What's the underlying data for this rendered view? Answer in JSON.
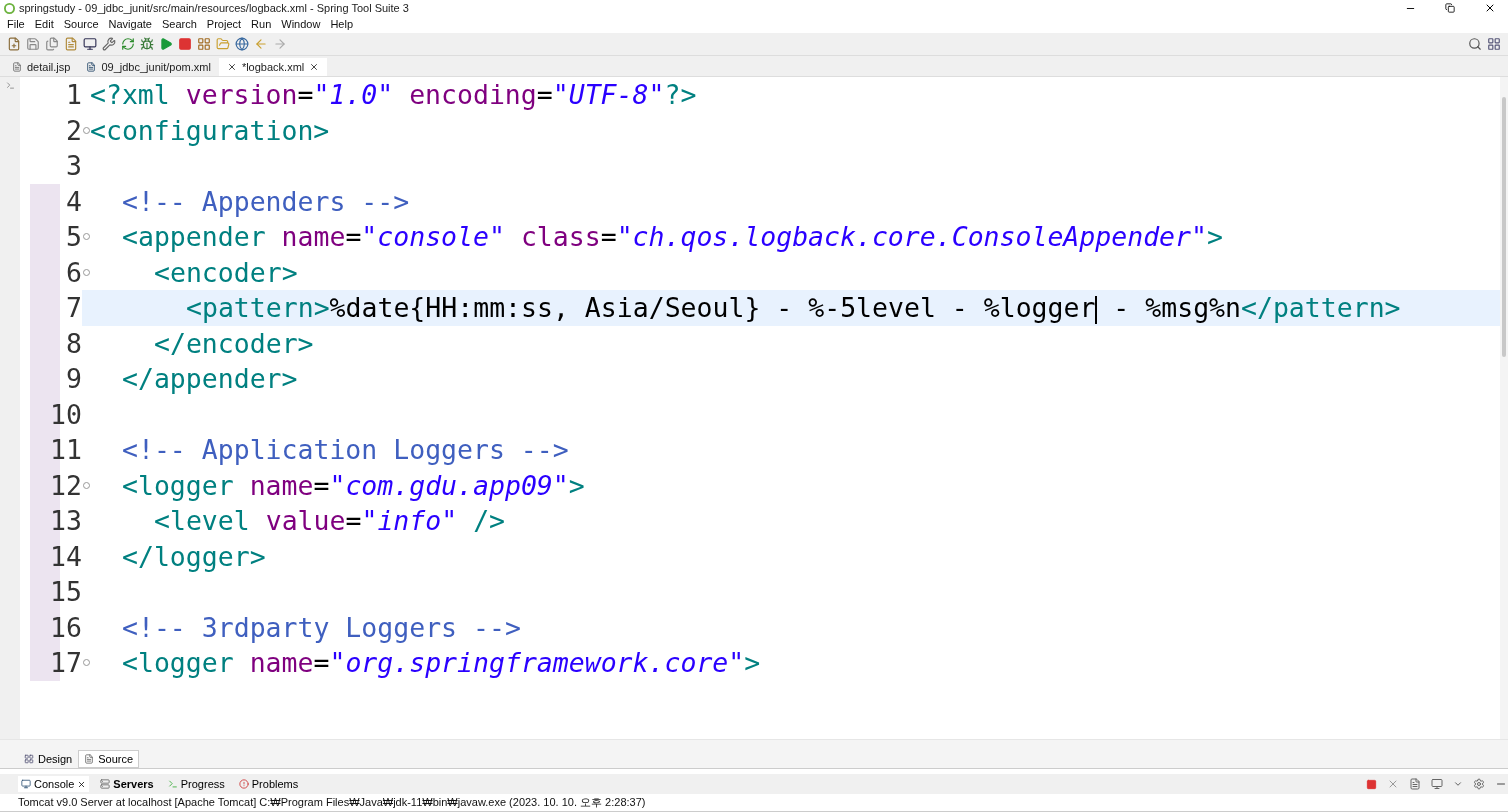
{
  "window": {
    "title": "springstudy - 09_jdbc_junit/src/main/resources/logback.xml - Spring Tool Suite 3"
  },
  "menu": [
    "File",
    "Edit",
    "Source",
    "Navigate",
    "Search",
    "Project",
    "Run",
    "Window",
    "Help"
  ],
  "editor_tabs": [
    {
      "label": "detail.jsp",
      "selected": false,
      "kind": "jsp"
    },
    {
      "label": "09_jdbc_junit/pom.xml",
      "selected": false,
      "kind": "maven"
    },
    {
      "label": "*logback.xml",
      "selected": true,
      "kind": "xml"
    }
  ],
  "code_lines": [
    {
      "number": "1",
      "foldable": false,
      "current": false,
      "tokens": [
        {
          "kind": "tag",
          "text": "<?xml "
        },
        {
          "kind": "attr",
          "text": "version"
        },
        {
          "kind": "plain",
          "text": "="
        },
        {
          "kind": "value",
          "text": "\"1.0\" "
        },
        {
          "kind": "attr",
          "text": "encoding"
        },
        {
          "kind": "plain",
          "text": "="
        },
        {
          "kind": "value",
          "text": "\"UTF-8\""
        },
        {
          "kind": "tag",
          "text": "?>"
        }
      ]
    },
    {
      "number": "2",
      "foldable": true,
      "current": false,
      "tokens": [
        {
          "kind": "tag",
          "text": "<configuration>"
        }
      ]
    },
    {
      "number": "3",
      "foldable": false,
      "current": false
    },
    {
      "number": "4",
      "foldable": false,
      "current": false,
      "tokens": [
        {
          "kind": "comment",
          "text": "  <!-- Appenders -->"
        }
      ]
    },
    {
      "number": "5",
      "foldable": true,
      "current": false,
      "tokens": [
        {
          "kind": "tag",
          "text": "  <appender "
        },
        {
          "kind": "attr",
          "text": "name"
        },
        {
          "kind": "plain",
          "text": "="
        },
        {
          "kind": "value",
          "text": "\"console\" "
        },
        {
          "kind": "attr",
          "text": "class"
        },
        {
          "kind": "plain",
          "text": "="
        },
        {
          "kind": "value",
          "text": "\"ch.qos.logback.core.ConsoleAppender\""
        },
        {
          "kind": "tag",
          "text": ">"
        }
      ]
    },
    {
      "number": "6",
      "foldable": true,
      "current": false,
      "tokens": [
        {
          "kind": "tag",
          "text": "    <encoder>"
        }
      ]
    },
    {
      "number": "7",
      "foldable": false,
      "current": true,
      "tokens": [
        {
          "kind": "tag",
          "text": "      <pattern>"
        },
        {
          "kind": "plain",
          "text": "%date{HH:mm:ss, Asia/Seoul} - %-5level - %logger"
        },
        {
          "kind": "caret"
        },
        {
          "kind": "plain",
          "text": " - %msg%n"
        },
        {
          "kind": "tag",
          "text": "</pattern>"
        }
      ]
    },
    {
      "number": "8",
      "foldable": false,
      "current": false,
      "tokens": [
        {
          "kind": "tag",
          "text": "    </encoder>"
        }
      ]
    },
    {
      "number": "9",
      "foldable": false,
      "current": false,
      "tokens": [
        {
          "kind": "tag",
          "text": "  </appender>"
        }
      ]
    },
    {
      "number": "10",
      "foldable": false,
      "current": false
    },
    {
      "number": "11",
      "foldable": false,
      "current": false,
      "tokens": [
        {
          "kind": "comment",
          "text": "  <!-- Application Loggers -->"
        }
      ]
    },
    {
      "number": "12",
      "foldable": true,
      "current": false,
      "tokens": [
        {
          "kind": "tag",
          "text": "  <logger "
        },
        {
          "kind": "attr",
          "text": "name"
        },
        {
          "kind": "plain",
          "text": "="
        },
        {
          "kind": "value",
          "text": "\"com.gdu.app09\""
        },
        {
          "kind": "tag",
          "text": ">"
        }
      ]
    },
    {
      "number": "13",
      "foldable": false,
      "current": false,
      "tokens": [
        {
          "kind": "tag",
          "text": "    <level "
        },
        {
          "kind": "attr",
          "text": "value"
        },
        {
          "kind": "plain",
          "text": "="
        },
        {
          "kind": "value",
          "text": "\"info\""
        },
        {
          "kind": "tag",
          "text": " />"
        }
      ]
    },
    {
      "number": "14",
      "foldable": false,
      "current": false,
      "tokens": [
        {
          "kind": "tag",
          "text": "  </logger>"
        }
      ]
    },
    {
      "number": "15",
      "foldable": false,
      "current": false
    },
    {
      "number": "16",
      "foldable": false,
      "current": false,
      "tokens": [
        {
          "kind": "comment",
          "text": "  <!-- 3rdparty Loggers -->"
        }
      ]
    },
    {
      "number": "17",
      "foldable": true,
      "current": false,
      "tokens": [
        {
          "kind": "tag",
          "text": "  <logger "
        },
        {
          "kind": "attr",
          "text": "name"
        },
        {
          "kind": "plain",
          "text": "="
        },
        {
          "kind": "value",
          "text": "\"org.springframework.core\""
        },
        {
          "kind": "tag",
          "text": ">"
        }
      ]
    }
  ],
  "editor_mode_tabs": [
    {
      "label": "Design",
      "selected": false
    },
    {
      "label": "Source",
      "selected": true
    }
  ],
  "console_tabs": [
    {
      "label": "Console",
      "selected": true,
      "bold": false
    },
    {
      "label": "Servers",
      "selected": false,
      "bold": true
    },
    {
      "label": "Progress",
      "selected": false,
      "bold": false
    },
    {
      "label": "Problems",
      "selected": false,
      "bold": false
    }
  ],
  "console": {
    "status": "Tomcat v9.0 Server at localhost [Apache Tomcat] C:₩Program Files₩Java₩jdk-11₩bin₩javaw.exe  (2023. 10. 10. 오후 2:28:37)"
  }
}
